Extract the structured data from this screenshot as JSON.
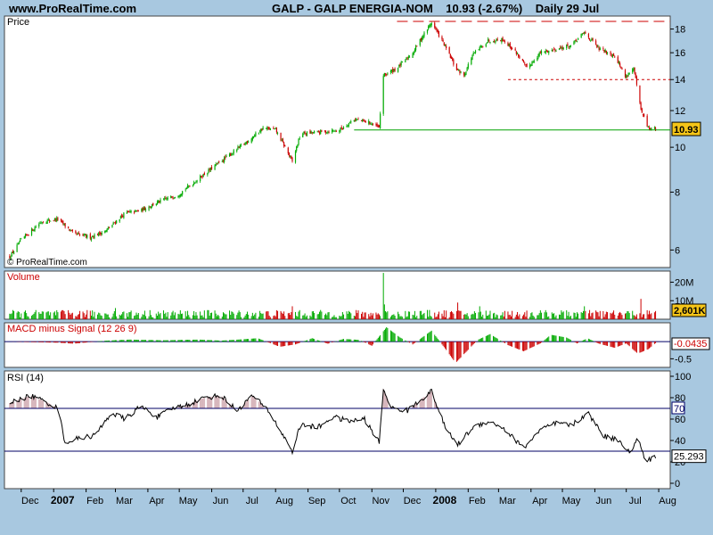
{
  "header": {
    "site": "www.ProRealTime.com",
    "instrument": "GALP - GALP ENERGIA-NOM",
    "quote": "10.93 (-2.67%)",
    "period": "Daily",
    "date": "29 Jul"
  },
  "watermark": "© ProRealTime.com",
  "colors": {
    "background": "#a8c8e0",
    "panel": "#ffffff",
    "up": "#00aa00",
    "down": "#cc0000",
    "support": "#00a000",
    "resistance": "#cc0000",
    "last_value_box": "#f5c518",
    "overbought_fill": "#d7b7bd"
  },
  "chart_data": [
    {
      "panel": "price",
      "type": "candlestick",
      "title": "Price",
      "y_ticks": [
        6,
        8,
        10,
        12,
        14,
        16,
        18
      ],
      "ylim": [
        5.5,
        19.2
      ],
      "scale": "log",
      "last_value": "10.93",
      "x_ticks": [
        "Dec",
        "2007",
        "Feb",
        "Mar",
        "Apr",
        "May",
        "Jun",
        "Jul",
        "Aug",
        "Sep",
        "Oct",
        "Nov",
        "Dec",
        "2008",
        "Feb",
        "Mar",
        "Apr",
        "May",
        "Jun",
        "Jul",
        "Aug"
      ],
      "close_path": [
        {
          "t": "2006-11-20",
          "v": 5.8
        },
        {
          "t": "2006-12-01",
          "v": 6.3
        },
        {
          "t": "2006-12-20",
          "v": 6.9
        },
        {
          "t": "2007-01-05",
          "v": 7.0
        },
        {
          "t": "2007-01-20",
          "v": 6.5
        },
        {
          "t": "2007-02-05",
          "v": 6.4
        },
        {
          "t": "2007-02-20",
          "v": 6.6
        },
        {
          "t": "2007-03-10",
          "v": 7.2
        },
        {
          "t": "2007-03-25",
          "v": 7.3
        },
        {
          "t": "2007-04-10",
          "v": 7.6
        },
        {
          "t": "2007-04-30",
          "v": 7.9
        },
        {
          "t": "2007-05-15",
          "v": 8.4
        },
        {
          "t": "2007-06-01",
          "v": 9.0
        },
        {
          "t": "2007-06-20",
          "v": 9.7
        },
        {
          "t": "2007-07-05",
          "v": 10.3
        },
        {
          "t": "2007-07-20",
          "v": 11.0
        },
        {
          "t": "2007-08-01",
          "v": 10.9
        },
        {
          "t": "2007-08-17",
          "v": 9.3
        },
        {
          "t": "2007-08-25",
          "v": 10.7
        },
        {
          "t": "2007-09-15",
          "v": 10.8
        },
        {
          "t": "2007-10-01",
          "v": 10.9
        },
        {
          "t": "2007-10-15",
          "v": 11.5
        },
        {
          "t": "2007-10-30",
          "v": 11.3
        },
        {
          "t": "2007-11-08",
          "v": 11.0
        },
        {
          "t": "2007-11-12",
          "v": 14.3
        },
        {
          "t": "2007-11-25",
          "v": 14.8
        },
        {
          "t": "2007-12-10",
          "v": 16.0
        },
        {
          "t": "2007-12-28",
          "v": 18.6
        },
        {
          "t": "2008-01-10",
          "v": 16.5
        },
        {
          "t": "2008-01-20",
          "v": 14.8
        },
        {
          "t": "2008-01-28",
          "v": 14.3
        },
        {
          "t": "2008-02-05",
          "v": 15.8
        },
        {
          "t": "2008-02-20",
          "v": 17.0
        },
        {
          "t": "2008-03-05",
          "v": 17.1
        },
        {
          "t": "2008-03-18",
          "v": 16.0
        },
        {
          "t": "2008-03-28",
          "v": 14.8
        },
        {
          "t": "2008-04-10",
          "v": 16.0
        },
        {
          "t": "2008-04-25",
          "v": 16.3
        },
        {
          "t": "2008-05-10",
          "v": 16.6
        },
        {
          "t": "2008-05-22",
          "v": 17.7
        },
        {
          "t": "2008-06-05",
          "v": 16.3
        },
        {
          "t": "2008-06-20",
          "v": 15.8
        },
        {
          "t": "2008-06-30",
          "v": 14.2
        },
        {
          "t": "2008-07-08",
          "v": 14.8
        },
        {
          "t": "2008-07-15",
          "v": 12.0
        },
        {
          "t": "2008-07-22",
          "v": 11.0
        },
        {
          "t": "2008-07-29",
          "v": 10.93
        }
      ],
      "annotations": [
        {
          "kind": "resistance-dashed",
          "y": 18.7,
          "from": "2007-11-25",
          "to": "2008-07-29"
        },
        {
          "kind": "resistance-dotted",
          "y": 14.0,
          "from": "2008-03-10",
          "to": "2008-07-29"
        },
        {
          "kind": "support",
          "y": 10.9,
          "from": "2007-10-15",
          "to": "2008-07-29"
        }
      ]
    },
    {
      "panel": "volume",
      "type": "bar",
      "title": "Volume",
      "y_ticks": [
        "20M",
        "10M"
      ],
      "y_tick_values": [
        20,
        10
      ],
      "ylim": [
        0,
        26
      ],
      "unit": "M",
      "last_value": "2,601K",
      "spikes": [
        {
          "t": "2007-11-12",
          "v": 25
        },
        {
          "t": "2007-11-13",
          "v": 8
        },
        {
          "t": "2008-01-22",
          "v": 9
        },
        {
          "t": "2008-07-15",
          "v": 11
        },
        {
          "t": "2007-08-17",
          "v": 7
        },
        {
          "t": "2008-05-22",
          "v": 7
        },
        {
          "t": "2007-03-01",
          "v": 6
        },
        {
          "t": "2008-02-12",
          "v": 7
        }
      ],
      "baseline": 2.5
    },
    {
      "panel": "macd",
      "type": "histogram",
      "title": "MACD minus Signal (12 26 9)",
      "y_ticks": [
        "-0.5"
      ],
      "y_tick_values": [
        -0.5
      ],
      "ylim": [
        -0.75,
        0.55
      ],
      "last_value": "-0.0435",
      "path": [
        {
          "t": "2006-11-20",
          "v": 0.0
        },
        {
          "t": "2007-01-05",
          "v": -0.03
        },
        {
          "t": "2007-01-20",
          "v": -0.06
        },
        {
          "t": "2007-02-20",
          "v": 0.03
        },
        {
          "t": "2007-03-15",
          "v": 0.06
        },
        {
          "t": "2007-04-15",
          "v": 0.04
        },
        {
          "t": "2007-05-20",
          "v": 0.06
        },
        {
          "t": "2007-06-10",
          "v": 0.03
        },
        {
          "t": "2007-07-01",
          "v": 0.07
        },
        {
          "t": "2007-07-15",
          "v": 0.1
        },
        {
          "t": "2007-08-05",
          "v": -0.15
        },
        {
          "t": "2007-08-20",
          "v": -0.08
        },
        {
          "t": "2007-09-05",
          "v": 0.1
        },
        {
          "t": "2007-09-20",
          "v": -0.06
        },
        {
          "t": "2007-10-05",
          "v": 0.08
        },
        {
          "t": "2007-10-20",
          "v": 0.05
        },
        {
          "t": "2007-11-01",
          "v": -0.12
        },
        {
          "t": "2007-11-15",
          "v": 0.42
        },
        {
          "t": "2007-11-28",
          "v": 0.12
        },
        {
          "t": "2007-12-10",
          "v": -0.08
        },
        {
          "t": "2007-12-28",
          "v": 0.32
        },
        {
          "t": "2008-01-10",
          "v": -0.2
        },
        {
          "t": "2008-01-20",
          "v": -0.62
        },
        {
          "t": "2008-01-30",
          "v": -0.3
        },
        {
          "t": "2008-02-10",
          "v": 0.05
        },
        {
          "t": "2008-02-22",
          "v": 0.22
        },
        {
          "t": "2008-03-10",
          "v": -0.1
        },
        {
          "t": "2008-03-25",
          "v": -0.28
        },
        {
          "t": "2008-04-10",
          "v": -0.05
        },
        {
          "t": "2008-04-20",
          "v": 0.2
        },
        {
          "t": "2008-05-05",
          "v": 0.12
        },
        {
          "t": "2008-05-15",
          "v": -0.05
        },
        {
          "t": "2008-05-25",
          "v": 0.1
        },
        {
          "t": "2008-06-05",
          "v": -0.06
        },
        {
          "t": "2008-06-20",
          "v": -0.18
        },
        {
          "t": "2008-07-01",
          "v": -0.05
        },
        {
          "t": "2008-07-12",
          "v": -0.35
        },
        {
          "t": "2008-07-22",
          "v": -0.22
        },
        {
          "t": "2008-07-29",
          "v": -0.0435
        }
      ]
    },
    {
      "panel": "rsi",
      "type": "line",
      "title": "RSI (14)",
      "y_ticks": [
        0,
        20,
        40,
        60,
        80,
        100
      ],
      "ylim": [
        -5,
        105
      ],
      "overbought": 70,
      "oversold": 30,
      "last_value": "25.293",
      "path": [
        {
          "t": "2006-11-20",
          "v": 75
        },
        {
          "t": "2006-12-10",
          "v": 82
        },
        {
          "t": "2006-12-25",
          "v": 76
        },
        {
          "t": "2007-01-05",
          "v": 70
        },
        {
          "t": "2007-01-12",
          "v": 38
        },
        {
          "t": "2007-01-25",
          "v": 42
        },
        {
          "t": "2007-02-10",
          "v": 45
        },
        {
          "t": "2007-02-25",
          "v": 66
        },
        {
          "t": "2007-03-10",
          "v": 60
        },
        {
          "t": "2007-03-25",
          "v": 72
        },
        {
          "t": "2007-04-10",
          "v": 62
        },
        {
          "t": "2007-04-25",
          "v": 70
        },
        {
          "t": "2007-05-10",
          "v": 74
        },
        {
          "t": "2007-05-25",
          "v": 80
        },
        {
          "t": "2007-06-10",
          "v": 82
        },
        {
          "t": "2007-06-25",
          "v": 68
        },
        {
          "t": "2007-07-10",
          "v": 82
        },
        {
          "t": "2007-07-25",
          "v": 68
        },
        {
          "t": "2007-08-05",
          "v": 50
        },
        {
          "t": "2007-08-17",
          "v": 30
        },
        {
          "t": "2007-08-25",
          "v": 55
        },
        {
          "t": "2007-09-10",
          "v": 52
        },
        {
          "t": "2007-09-25",
          "v": 62
        },
        {
          "t": "2007-10-10",
          "v": 58
        },
        {
          "t": "2007-10-25",
          "v": 60
        },
        {
          "t": "2007-11-08",
          "v": 38
        },
        {
          "t": "2007-11-12",
          "v": 88
        },
        {
          "t": "2007-11-20",
          "v": 70
        },
        {
          "t": "2007-12-05",
          "v": 68
        },
        {
          "t": "2007-12-20",
          "v": 80
        },
        {
          "t": "2007-12-28",
          "v": 86
        },
        {
          "t": "2008-01-10",
          "v": 52
        },
        {
          "t": "2008-01-22",
          "v": 36
        },
        {
          "t": "2008-02-05",
          "v": 52
        },
        {
          "t": "2008-02-20",
          "v": 58
        },
        {
          "t": "2008-03-05",
          "v": 52
        },
        {
          "t": "2008-03-25",
          "v": 33
        },
        {
          "t": "2008-04-10",
          "v": 50
        },
        {
          "t": "2008-04-25",
          "v": 56
        },
        {
          "t": "2008-05-10",
          "v": 54
        },
        {
          "t": "2008-05-25",
          "v": 66
        },
        {
          "t": "2008-06-10",
          "v": 44
        },
        {
          "t": "2008-06-25",
          "v": 40
        },
        {
          "t": "2008-07-05",
          "v": 28
        },
        {
          "t": "2008-07-12",
          "v": 42
        },
        {
          "t": "2008-07-20",
          "v": 20
        },
        {
          "t": "2008-07-29",
          "v": 25.293
        }
      ]
    }
  ]
}
